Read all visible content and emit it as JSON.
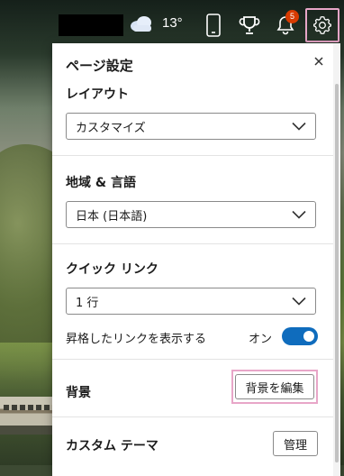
{
  "topbar": {
    "weather_icon": "cloud-icon",
    "temperature": "13°",
    "notification_count": "5",
    "icons": [
      "phone-icon",
      "trophy-icon",
      "bell-icon",
      "gear-icon"
    ]
  },
  "panel": {
    "title": "ページ設定",
    "close_label": "×",
    "layout": {
      "label": "レイアウト",
      "value": "カスタマイズ"
    },
    "region": {
      "label": "地域 & 言語",
      "value": "日本 (日本語)"
    },
    "quick_links": {
      "label": "クイック リンク",
      "value": "1 行",
      "promoted_label": "昇格したリンクを表示する",
      "toggle_state": "オン"
    },
    "background": {
      "label": "背景",
      "button": "背景を編集"
    },
    "custom_theme": {
      "label": "カスタム テーマ",
      "button": "管理"
    }
  },
  "colors": {
    "accent": "#0f6cbd",
    "highlight": "#e8a6c8",
    "badge": "#d83b01"
  }
}
